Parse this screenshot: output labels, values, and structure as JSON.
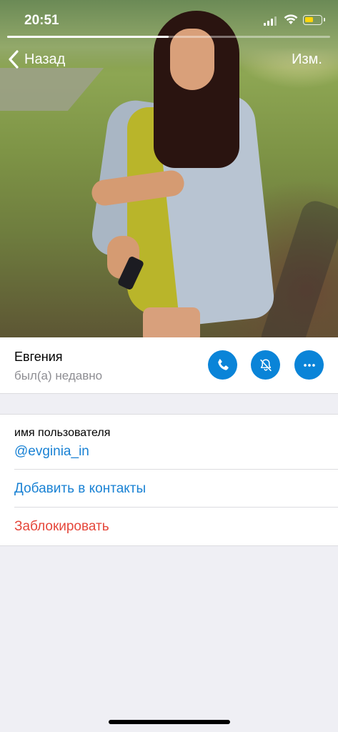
{
  "status_bar": {
    "time": "20:51",
    "battery_level": 0.5,
    "battery_color": "#ffd60a"
  },
  "story_progress": 0.5,
  "nav": {
    "back_label": "Назад",
    "edit_label": "Изм."
  },
  "profile": {
    "name": "Евгения",
    "last_seen": "был(а) недавно"
  },
  "actions": [
    {
      "icon": "phone-icon"
    },
    {
      "icon": "bell-slash-icon"
    },
    {
      "icon": "more-icon"
    }
  ],
  "info": {
    "username_label": "имя пользователя",
    "username_value": "@evginia_in",
    "add_contact_label": "Добавить в контакты",
    "block_label": "Заблокировать"
  },
  "colors": {
    "accent": "#1a82d4",
    "action_button": "#0a84d8",
    "destructive": "#e5473b",
    "background": "#efeff4"
  }
}
